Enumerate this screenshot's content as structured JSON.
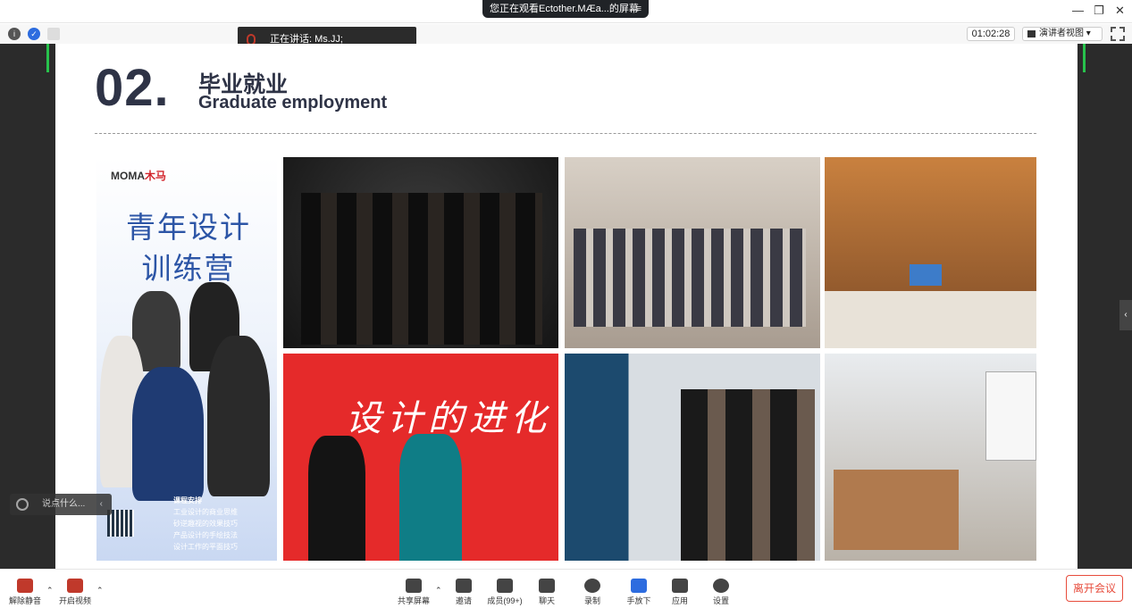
{
  "titlebar": {
    "share_status": "您正在观看Ectother.MÆa...的屏幕",
    "menu_icon": "≡"
  },
  "speaker": {
    "label": "正在讲话: Ms.JJ;"
  },
  "timer": "01:02:28",
  "view_button": "演讲者视图",
  "slide": {
    "number": "02.",
    "title_zh": "毕业就业",
    "title_en": "Graduate employment",
    "poster": {
      "logo": "MOMA",
      "logo_suffix": "木马",
      "headline": "青年设计 训练营",
      "bullets": [
        "工业设计的商业思维",
        "砂逆趣视的效果技巧",
        "产品设计的手绘技法",
        "设计工作的平面技巧"
      ],
      "course_label": "课程安排"
    },
    "banner_text": "设计的进化"
  },
  "comment_box": {
    "placeholder": "说点什么..."
  },
  "toolbar": {
    "unmute": "解除静音",
    "start_video": "开启视频",
    "share_screen": "共享屏幕",
    "invite": "邀请",
    "members": "成员(99+)",
    "chat": "聊天",
    "record": "录制",
    "raise_hand": "手放下",
    "apps": "应用",
    "settings": "设置",
    "leave": "离开会议"
  },
  "colors": {
    "accent_green": "#27c24c",
    "leave_red": "#e74c3c",
    "slide_title": "#2e3346"
  }
}
